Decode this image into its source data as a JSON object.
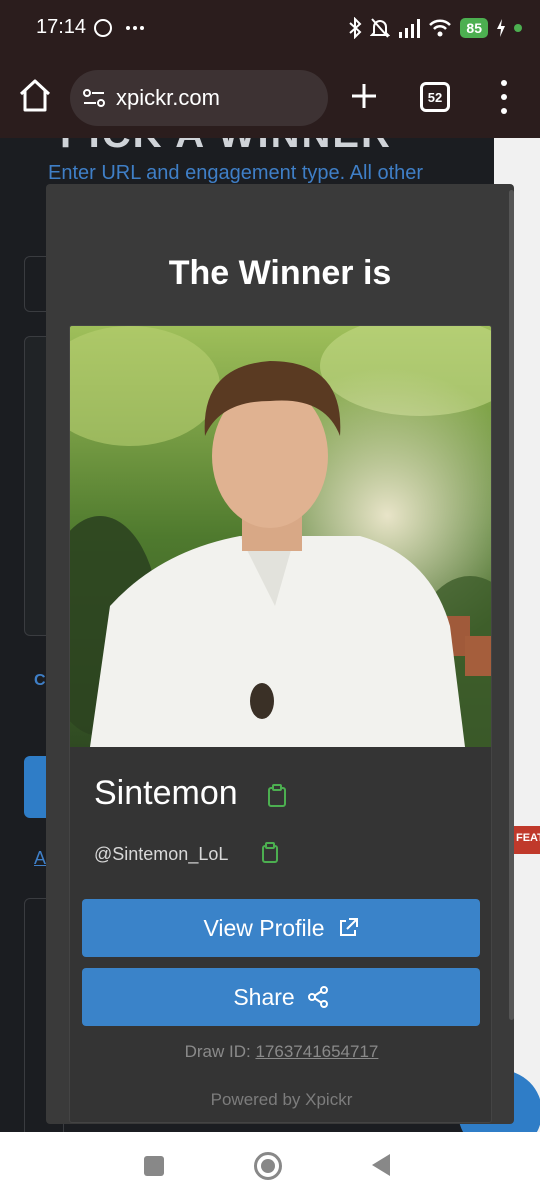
{
  "status_bar": {
    "time": "17:14",
    "left_icons": "○ ···",
    "battery": "85",
    "icon_names": [
      "whatsapp-icon",
      "more-icon",
      "bluetooth-icon",
      "mute-icon",
      "signal-icon",
      "wifi-icon",
      "battery-icon",
      "charging-icon"
    ]
  },
  "browser": {
    "url": "xpickr.com",
    "tab_count": "52"
  },
  "background_page": {
    "title": "PICK A WINNER",
    "subtitle": "Enter URL and engagement type. All other",
    "text_fragment": "C fr",
    "link_fragment": "A",
    "feature_tag": "FEATU"
  },
  "modal": {
    "title": "The Winner is",
    "winner_name": "Sintemon",
    "winner_handle": "@Sintemon_LoL",
    "view_profile_label": "View Profile",
    "share_label": "Share",
    "draw_id_label": "Draw ID:",
    "draw_id_value": "1763741654717",
    "powered_by": "Powered by Xpickr"
  },
  "colors": {
    "accent_blue": "#3a83c9",
    "copy_icon_green": "#4caf50",
    "modal_bg": "#3a3a3a"
  }
}
